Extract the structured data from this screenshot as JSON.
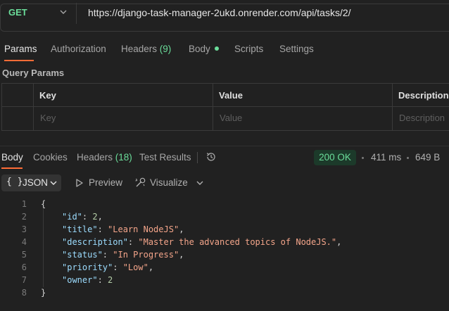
{
  "request": {
    "method": "GET",
    "url": "https://django-task-manager-2ukd.onrender.com/api/tasks/2/"
  },
  "request_tabs": [
    {
      "label": "Params"
    },
    {
      "label": "Authorization"
    },
    {
      "label": "Headers",
      "count": "(9)"
    },
    {
      "label": "Body"
    },
    {
      "label": "Scripts"
    },
    {
      "label": "Settings"
    }
  ],
  "query_params": {
    "title": "Query Params",
    "headers": [
      "Key",
      "Value",
      "Description"
    ],
    "placeholders": [
      "Key",
      "Value",
      "Description"
    ]
  },
  "response_tabs": [
    {
      "label": "Body"
    },
    {
      "label": "Cookies"
    },
    {
      "label": "Headers",
      "count": "(18)"
    },
    {
      "label": "Test Results"
    }
  ],
  "response_meta": {
    "status": "200 OK",
    "time": "411 ms",
    "size": "649 B"
  },
  "format_toolbar": {
    "format": "JSON",
    "preview": "Preview",
    "visualize": "Visualize"
  },
  "code": {
    "line_numbers": [
      "1",
      "2",
      "3",
      "4",
      "5",
      "6",
      "7",
      "8"
    ],
    "open_brace": "{",
    "close_brace": "}",
    "fields": [
      {
        "key": "\"id\"",
        "value": "2",
        "kind": "n",
        "comma": ","
      },
      {
        "key": "\"title\"",
        "value": "\"Learn NodeJS\"",
        "kind": "s",
        "comma": ","
      },
      {
        "key": "\"description\"",
        "value": "\"Master the advanced topics of NodeJS.\"",
        "kind": "s",
        "comma": ","
      },
      {
        "key": "\"status\"",
        "value": "\"In Progress\"",
        "kind": "s",
        "comma": ","
      },
      {
        "key": "\"priority\"",
        "value": "\"Low\"",
        "kind": "s",
        "comma": ","
      },
      {
        "key": "\"owner\"",
        "value": "2",
        "kind": "n",
        "comma": ""
      }
    ]
  },
  "colors": {
    "background": "#212121",
    "accent": "#ff6c37",
    "method_get": "#6bdd9a",
    "status_ok": "#6bdd9a"
  }
}
